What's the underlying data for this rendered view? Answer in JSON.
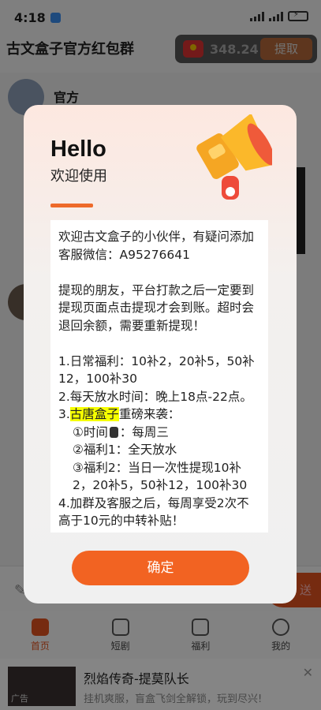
{
  "status_bar": {
    "time": "4:18"
  },
  "header": {
    "group_title": "古文盒子官方红包群",
    "balance": "348.24",
    "withdraw_label": "提取"
  },
  "chat": {
    "sender": "官方"
  },
  "input_bar": {
    "send_label": "送"
  },
  "nav": {
    "items": [
      {
        "label": "首页",
        "icon": "home-icon",
        "active": true
      },
      {
        "label": "短剧",
        "icon": "play-icon",
        "active": false
      },
      {
        "label": "福利",
        "icon": "gift-icon",
        "active": false
      },
      {
        "label": "我的",
        "icon": "person-icon",
        "active": false
      }
    ]
  },
  "ad": {
    "tag": "广告",
    "title": "烈焰传奇-提莫队长",
    "desc": "挂机爽服，盲盒飞剑全解锁，玩到尽兴!"
  },
  "modal": {
    "hello": "Hello",
    "subtitle": "欢迎使用",
    "notice": {
      "p1": "欢迎古文盒子的小伙伴，有疑问添加客服微信：A95276641",
      "p2": "提现的朋友，平台打款之后一定要到提现页面点击提现才会到账。超时会退回余额，需要重新提现！",
      "l1": "1.日常福利：10补2，20补5，50补12，100补30",
      "l2": "2.每天放水时间：晚上18点-22点。",
      "l3_prefix": "3.",
      "l3_highlight": "古唐盒子",
      "l3_suffix": "重磅来袭：",
      "l3a_pre": "①时间",
      "l3a_post": "：每周三",
      "l3b": "②福利1：全天放水",
      "l3c": "③福利2：当日一次性提现10补2，20补5，50补12，100补30",
      "l4": "4.加群及客服之后，每周享受2次不高于10元的中转补贴！"
    },
    "confirm_label": "确定"
  },
  "colors": {
    "accent": "#f26322",
    "highlight": "#f6ff00",
    "balance_pill": "#555555"
  }
}
